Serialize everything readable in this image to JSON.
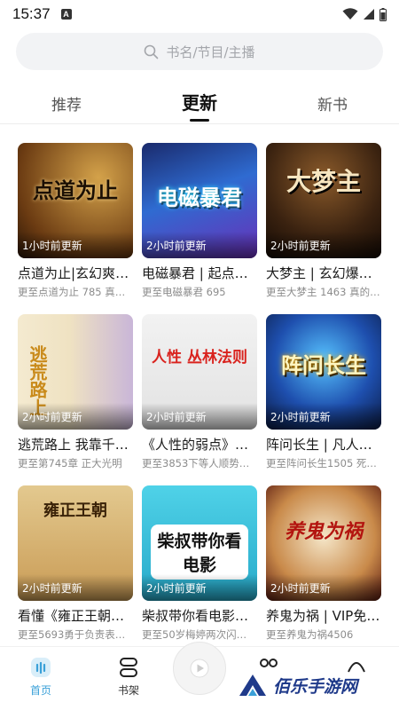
{
  "status_bar": {
    "time": "15:37",
    "app_letter": "A"
  },
  "search": {
    "placeholder": "书名/节目/主播"
  },
  "tabs": [
    {
      "label": "推荐",
      "active": false
    },
    {
      "label": "更新",
      "active": true
    },
    {
      "label": "新书",
      "active": false
    }
  ],
  "books": [
    {
      "cover_text": "点道为止",
      "badge": "1小时前更新",
      "title": "点道为止|玄幻爽文…",
      "subtitle": "更至点道为止 785 真…"
    },
    {
      "cover_text": "电磁暴君",
      "badge": "2小时前更新",
      "title": "电磁暴君 | 起点…",
      "subtitle": "更至电磁暴君 695"
    },
    {
      "cover_text": "大梦主",
      "badge": "2小时前更新",
      "title": "大梦主 | 玄幻爆…",
      "subtitle": "更至大梦主 1463 真的…"
    },
    {
      "cover_text": "逃荒路上",
      "badge": "2小时前更新",
      "title": "逃荒路上 我靠千…",
      "subtitle": "更至第745章 正大光明"
    },
    {
      "cover_text": "人性 丛林法则",
      "badge": "2小时前更新",
      "title": "《人性的弱点》…",
      "subtitle": "更至3853下等人顺势…"
    },
    {
      "cover_text": "阵问长生",
      "badge": "2小时前更新",
      "title": "阵问长生 | 凡人…",
      "subtitle": "更至阵问长生1505 死…"
    },
    {
      "cover_text": "雍正王朝",
      "badge": "2小时前更新",
      "title": "看懂《雍正王朝…",
      "subtitle": "更至5693勇于负责表…"
    },
    {
      "cover_text": "柴叔带你看电影",
      "badge": "2小时前更新",
      "title": "柴叔带你看电影…",
      "subtitle": "更至50岁梅婷两次闪…"
    },
    {
      "cover_text": "养鬼为祸",
      "badge": "2小时前更新",
      "title": "养鬼为祸 | VIP免…",
      "subtitle": "更至养鬼为祸4506"
    }
  ],
  "bottom_nav": [
    {
      "label": "首页",
      "icon": "home-icon",
      "active": true
    },
    {
      "label": "书架",
      "icon": "bookshelf-icon",
      "active": false
    }
  ],
  "watermark": {
    "text": "佰乐手游网"
  },
  "colors": {
    "accent": "#3aa0d8",
    "watermark": "#1f3a8a"
  }
}
